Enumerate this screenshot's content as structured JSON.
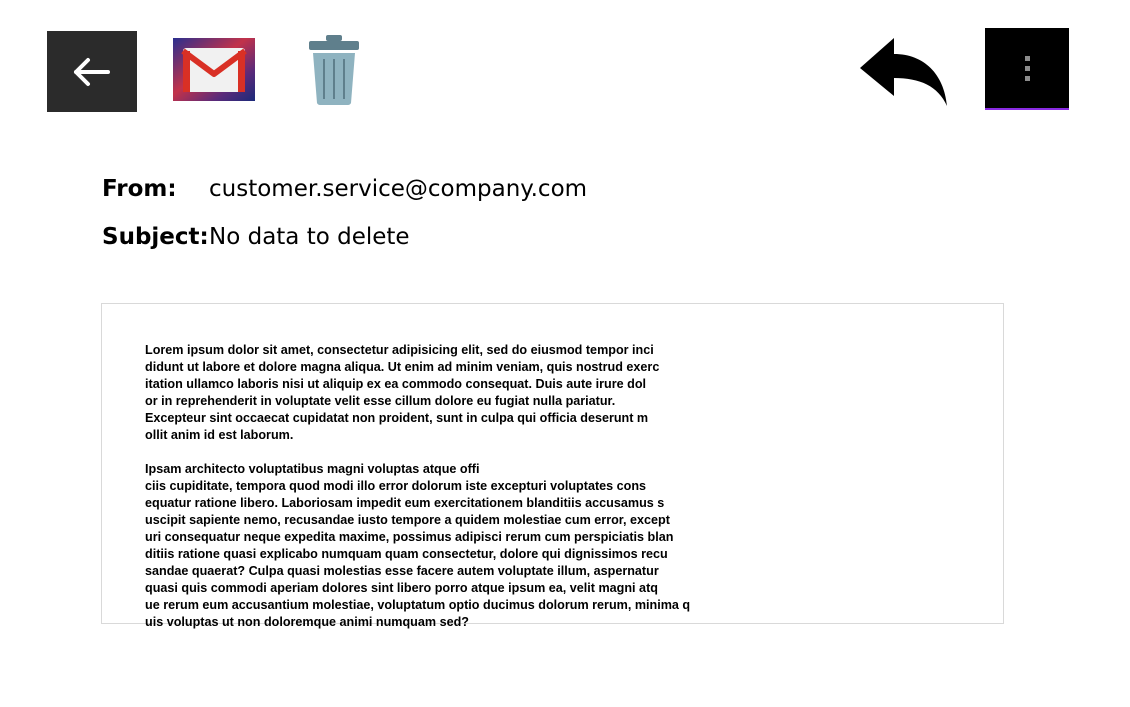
{
  "toolbar": {
    "back_icon": "arrow-left-icon",
    "gmail_icon": "gmail-icon",
    "trash_icon": "trash-icon",
    "reply_icon": "reply-icon",
    "more_icon": "more-vertical-icon",
    "accent_color": "#8a2be2"
  },
  "email": {
    "from_label": "From:",
    "from_value": "customer.service@company.com",
    "subject_label": "Subject:",
    "subject_value": "No data to delete",
    "body": {
      "paragraph_1": [
        "Lorem ipsum dolor sit amet, consectetur adipisicing elit, sed do eiusmod tempor inci",
        "didunt ut labore et dolore magna aliqua. Ut enim ad minim veniam, quis nostrud exerc",
        "itation ullamco laboris nisi ut aliquip ex ea commodo consequat. Duis aute irure dol",
        "or in reprehenderit in voluptate velit esse cillum dolore eu fugiat nulla pariatur.",
        "Excepteur sint occaecat cupidatat non proident, sunt in culpa qui officia deserunt m",
        "ollit anim id est laborum."
      ],
      "paragraph_2": [
        "Ipsam architecto voluptatibus magni voluptas atque offi",
        "ciis cupiditate, tempora quod modi illo error dolorum iste excepturi voluptates cons",
        "equatur ratione libero. Laboriosam impedit eum exercitationem blanditiis accusamus s",
        "uscipit sapiente nemo, recusandae iusto tempore a quidem molestiae cum error, except",
        "uri consequatur neque expedita maxime, possimus adipisci rerum cum perspiciatis blan",
        "ditiis ratione quasi explicabo numquam quam consectetur, dolore qui dignissimos recu",
        "sandae quaerat? Culpa quasi molestias esse facere autem voluptate illum, aspernatur",
        "quasi quis commodi aperiam dolores sint libero porro atque ipsum ea, velit magni atq",
        "ue rerum eum accusantium molestiae, voluptatum optio ducimus dolorum rerum, minima q",
        "uis voluptas ut non doloremque animi numquam sed?"
      ]
    }
  }
}
